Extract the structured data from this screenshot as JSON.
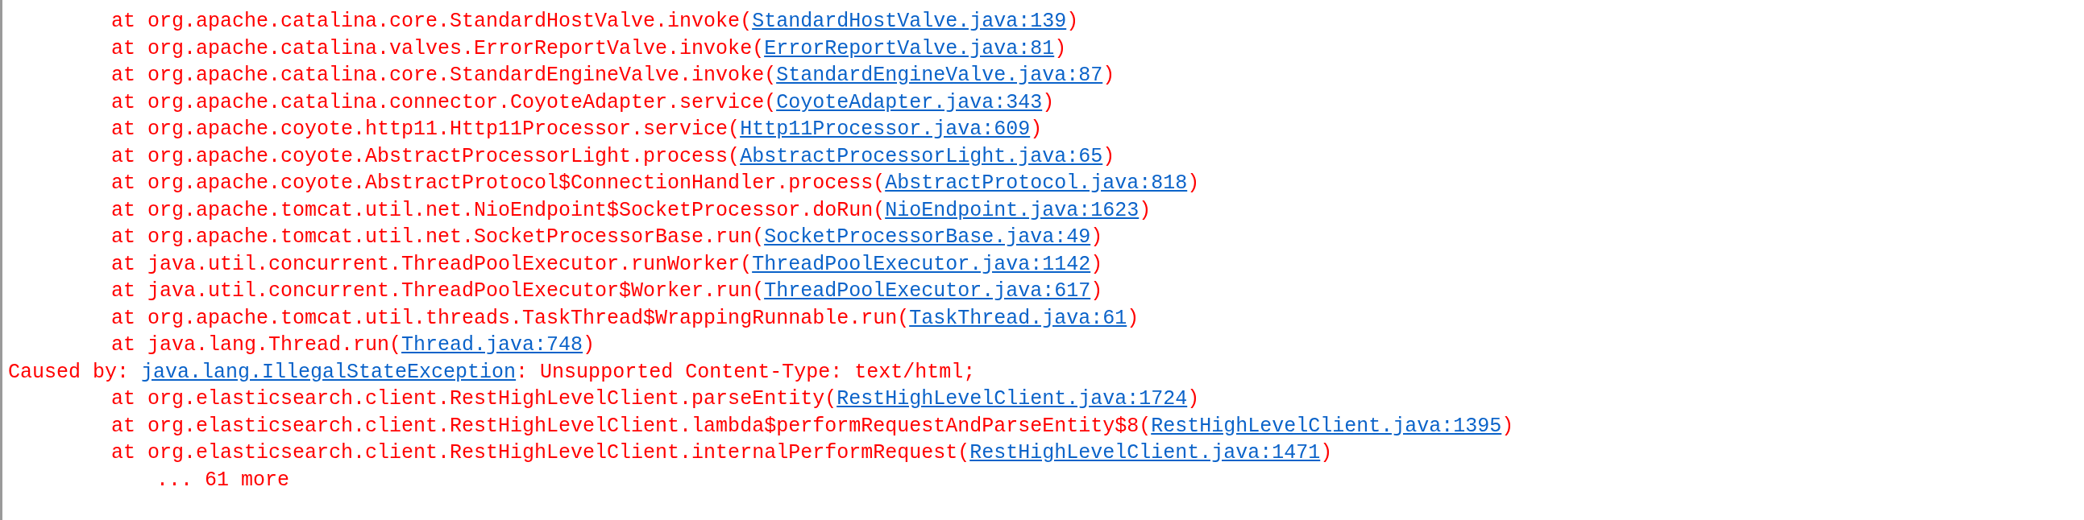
{
  "console": {
    "lines": [
      {
        "kind": "frame",
        "text": "at org.apache.catalina.core.StandardHostValve.invoke(",
        "link": "StandardHostValve.java:139",
        "after": ")"
      },
      {
        "kind": "frame",
        "text": "at org.apache.catalina.valves.ErrorReportValve.invoke(",
        "link": "ErrorReportValve.java:81",
        "after": ")"
      },
      {
        "kind": "frame",
        "text": "at org.apache.catalina.core.StandardEngineValve.invoke(",
        "link": "StandardEngineValve.java:87",
        "after": ")"
      },
      {
        "kind": "frame",
        "text": "at org.apache.catalina.connector.CoyoteAdapter.service(",
        "link": "CoyoteAdapter.java:343",
        "after": ")"
      },
      {
        "kind": "frame",
        "text": "at org.apache.coyote.http11.Http11Processor.service(",
        "link": "Http11Processor.java:609",
        "after": ")"
      },
      {
        "kind": "frame",
        "text": "at org.apache.coyote.AbstractProcessorLight.process(",
        "link": "AbstractProcessorLight.java:65",
        "after": ")"
      },
      {
        "kind": "frame",
        "text": "at org.apache.coyote.AbstractProtocol$ConnectionHandler.process(",
        "link": "AbstractProtocol.java:818",
        "after": ")"
      },
      {
        "kind": "frame",
        "text": "at org.apache.tomcat.util.net.NioEndpoint$SocketProcessor.doRun(",
        "link": "NioEndpoint.java:1623",
        "after": ")"
      },
      {
        "kind": "frame",
        "text": "at org.apache.tomcat.util.net.SocketProcessorBase.run(",
        "link": "SocketProcessorBase.java:49",
        "after": ")"
      },
      {
        "kind": "frame",
        "text": "at java.util.concurrent.ThreadPoolExecutor.runWorker(",
        "link": "ThreadPoolExecutor.java:1142",
        "after": ")"
      },
      {
        "kind": "frame",
        "text": "at java.util.concurrent.ThreadPoolExecutor$Worker.run(",
        "link": "ThreadPoolExecutor.java:617",
        "after": ")"
      },
      {
        "kind": "frame",
        "text": "at org.apache.tomcat.util.threads.TaskThread$WrappingRunnable.run(",
        "link": "TaskThread.java:61",
        "after": ")"
      },
      {
        "kind": "frame",
        "text": "at java.lang.Thread.run(",
        "link": "Thread.java:748",
        "after": ")"
      },
      {
        "kind": "cause",
        "text": "Caused by: ",
        "link": "java.lang.IllegalStateException",
        "after": ": Unsupported Content-Type: text/html;"
      },
      {
        "kind": "frame",
        "text": "at org.elasticsearch.client.RestHighLevelClient.parseEntity(",
        "link": "RestHighLevelClient.java:1724",
        "after": ")"
      },
      {
        "kind": "frame",
        "text": "at org.elasticsearch.client.RestHighLevelClient.lambda$performRequestAndParseEntity$8(",
        "link": "RestHighLevelClient.java:1395",
        "after": ")"
      },
      {
        "kind": "frame",
        "text": "at org.elasticsearch.client.RestHighLevelClient.internalPerformRequest(",
        "link": "RestHighLevelClient.java:1471",
        "after": ")"
      },
      {
        "kind": "more",
        "text": "... 61 more"
      }
    ]
  }
}
